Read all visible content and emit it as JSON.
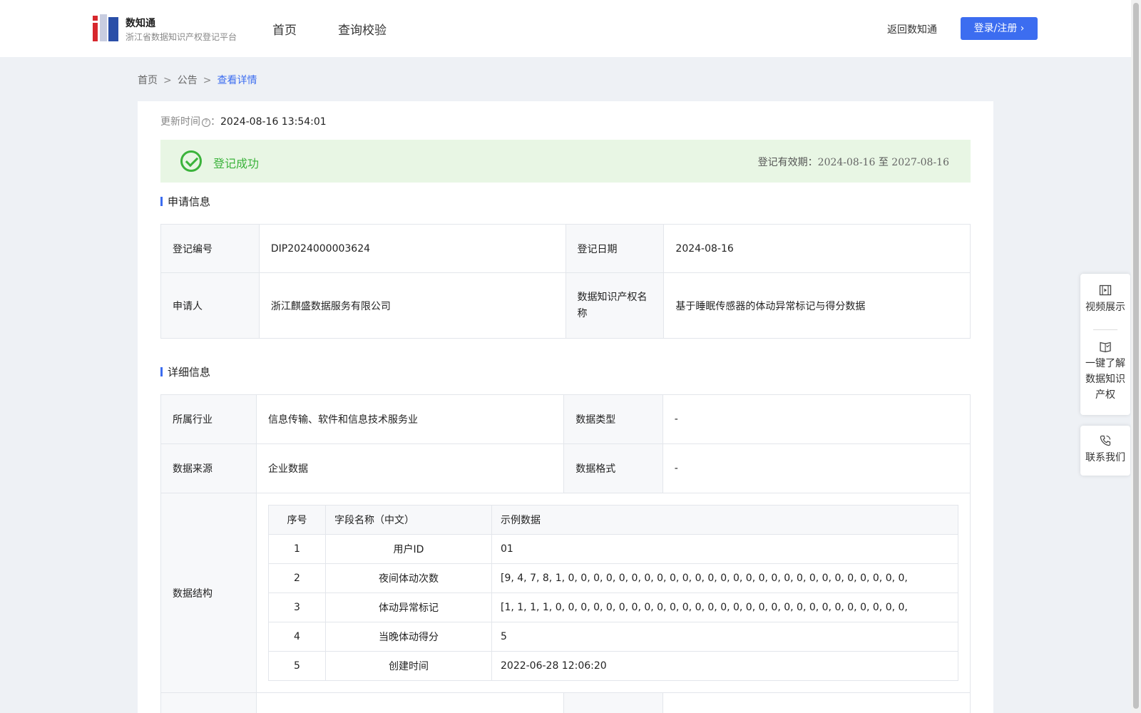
{
  "header": {
    "brand_name": "数知通",
    "brand_sub": "浙江省数据知识产权登记平台",
    "nav": [
      "首页",
      "查询校验"
    ],
    "back_label": "返回数知通",
    "login_label": "登录/注册"
  },
  "breadcrumb": {
    "home": "首页",
    "sep": ">",
    "notice": "公告",
    "current": "查看详情"
  },
  "update": {
    "label": "更新时间",
    "value": "2024-08-16 13:54:01"
  },
  "status": {
    "text": "登记成功",
    "validity_label": "登记有效期：",
    "validity_from": "2024-08-16",
    "validity_to_word": "至",
    "validity_to": "2027-08-16"
  },
  "application": {
    "title": "申请信息",
    "reg_no_label": "登记编号",
    "reg_no": "DIP2024000003624",
    "reg_date_label": "登记日期",
    "reg_date": "2024-08-16",
    "applicant_label": "申请人",
    "applicant": "浙江麒盛数据服务有限公司",
    "ip_name_label": "数据知识产权名称",
    "ip_name": "基于睡眠传感器的体动异常标记与得分数据"
  },
  "detail": {
    "title": "详细信息",
    "industry_label": "所属行业",
    "industry": "信息传输、软件和信息技术服务业",
    "data_type_label": "数据类型",
    "data_type": "-",
    "source_label": "数据来源",
    "source": "企业数据",
    "format_label": "数据格式",
    "format": "-",
    "structure_label": "数据结构",
    "structure_headers": [
      "序号",
      "字段名称（中文）",
      "示例数据"
    ],
    "structure_rows": [
      [
        "1",
        "用户ID",
        "01"
      ],
      [
        "2",
        "夜间体动次数",
        "[9, 4, 7, 8, 1, 0, 0, 0, 0, 0, 0, 0, 0, 0, 0, 0, 0, 0, 0, 0, 0, 0, 0, 0, 0, 0, 0, 0, 0, 0, 0, 0,"
      ],
      [
        "3",
        "体动异常标记",
        "[1, 1, 1, 1, 0, 0, 0, 0, 0, 0, 0, 0, 0, 0, 0, 0, 0, 0, 0, 0, 0, 0, 0, 0, 0, 0, 0, 0, 0, 0, 0, 0,"
      ],
      [
        "4",
        "当晚体动得分",
        "5"
      ],
      [
        "5",
        "创建时间",
        "2022-06-28 12:06:20"
      ]
    ]
  },
  "side_panel": {
    "video": "视频展示",
    "learn_lines": [
      "一键了解",
      "数据知识",
      "产权"
    ],
    "contact": "联系我们"
  },
  "colors": {
    "accent": "#3c6df0",
    "success": "#3bb33b",
    "success_bg": "#e8f6e4"
  }
}
